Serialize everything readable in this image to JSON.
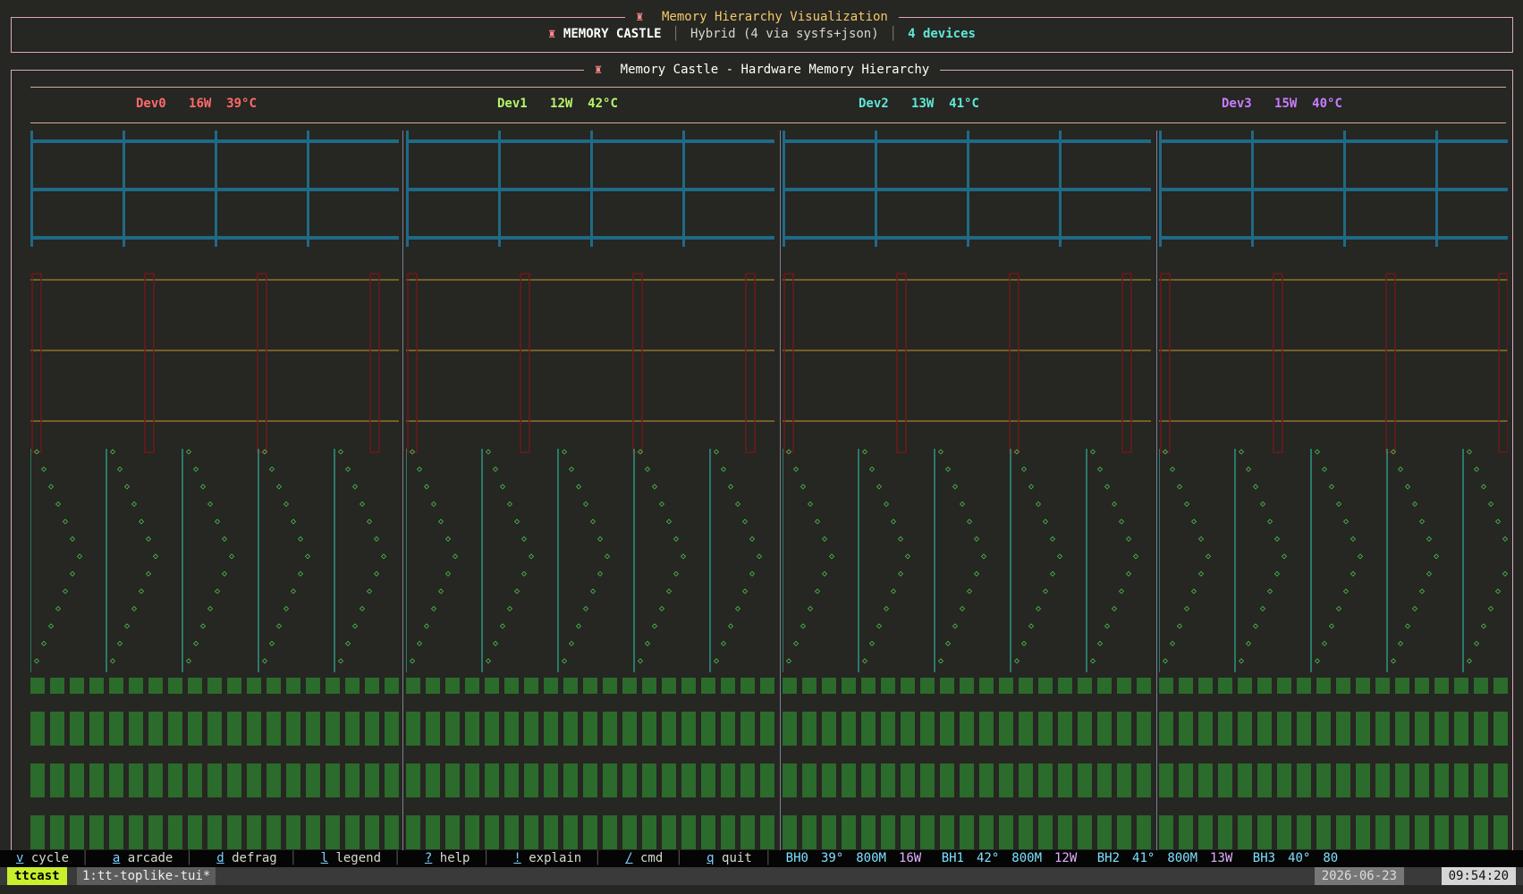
{
  "top": {
    "title": "Memory Hierarchy Visualization",
    "app_name": "MEMORY CASTLE",
    "mode": "Hybrid (4 via sysfs+json)",
    "device_count": "4 devices"
  },
  "main": {
    "title": "Memory Castle - Hardware Memory Hierarchy",
    "devices": [
      {
        "name": "Dev0",
        "power": "16W",
        "temp": "39°C",
        "color": "#ff6b6b"
      },
      {
        "name": "Dev1",
        "power": "12W",
        "temp": "42°C",
        "color": "#b5f56a"
      },
      {
        "name": "Dev2",
        "power": "13W",
        "temp": "41°C",
        "color": "#5ee8d8"
      },
      {
        "name": "Dev3",
        "power": "15W",
        "temp": "40°C",
        "color": "#c77dff"
      }
    ]
  },
  "colors": {
    "sram": "#1f6a86",
    "l2_line": "#c49a2a",
    "l2_bar": "#6b1a1a",
    "diamond": "#4fd64f",
    "vline": "#2fcfb0",
    "dram": "#2b6b2b"
  },
  "statusbar": {
    "shortcuts": [
      {
        "key": "v",
        "label": "cycle"
      },
      {
        "key": "a",
        "label": "arcade"
      },
      {
        "key": "d",
        "label": "defrag"
      },
      {
        "key": "l",
        "label": "legend"
      },
      {
        "key": "?",
        "label": "help"
      },
      {
        "key": "!",
        "label": "explain"
      },
      {
        "key": "/",
        "label": "cmd"
      },
      {
        "key": "q",
        "label": "quit"
      }
    ],
    "boards": [
      {
        "name": "BH0",
        "temp": "39°",
        "clock": "800M",
        "power": "16W"
      },
      {
        "name": "BH1",
        "temp": "42°",
        "clock": "800M",
        "power": "12W"
      },
      {
        "name": "BH2",
        "temp": "41°",
        "clock": "800M",
        "power": "13W"
      },
      {
        "name": "BH3",
        "temp": "40°",
        "clock": "80",
        "power": ""
      }
    ]
  },
  "tmux": {
    "session": "ttcast",
    "window": "1:tt-toplike-tui*",
    "date": "2026-06-23",
    "time": "09:54:20"
  }
}
